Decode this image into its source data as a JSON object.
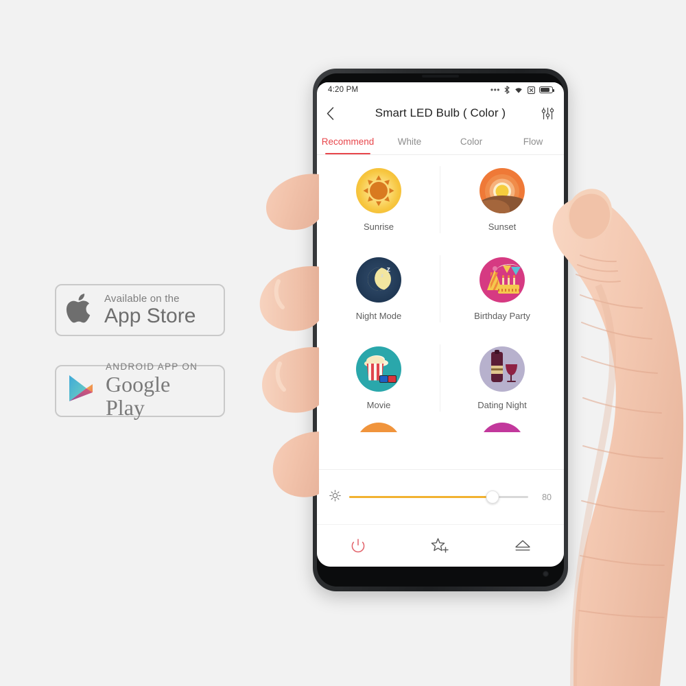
{
  "badges": {
    "appstore": {
      "small": "Available on the",
      "big": "App Store",
      "icon": "apple-logo-icon"
    },
    "googleplay": {
      "small": "ANDROID APP ON",
      "big": "Google Play",
      "icon": "google-play-triangle-icon"
    }
  },
  "phone": {
    "statusbar": {
      "time": "4:20 PM",
      "icons": [
        "more-dots-icon",
        "bluetooth-icon",
        "wifi-icon",
        "alarm-icon",
        "battery-icon"
      ]
    },
    "appbar": {
      "back_icon": "chevron-left-icon",
      "title": "Smart LED Bulb ( Color )",
      "settings_icon": "sliders-icon"
    },
    "tabs": [
      {
        "label": "Recommend",
        "active": true
      },
      {
        "label": "White",
        "active": false
      },
      {
        "label": "Color",
        "active": false
      },
      {
        "label": "Flow",
        "active": false
      }
    ],
    "scenes": [
      {
        "label": "Sunrise",
        "icon": "sunrise-icon"
      },
      {
        "label": "Sunset",
        "icon": "sunset-icon"
      },
      {
        "label": "Night Mode",
        "icon": "night-mode-icon"
      },
      {
        "label": "Birthday Party",
        "icon": "birthday-party-icon"
      },
      {
        "label": "Movie",
        "icon": "movie-icon"
      },
      {
        "label": "Dating Night",
        "icon": "dating-night-icon"
      }
    ],
    "brightness": {
      "icon": "brightness-icon",
      "value": "80",
      "percent": 80
    },
    "toolbar": [
      {
        "name": "power-icon",
        "label": "Power"
      },
      {
        "name": "star-plus-icon",
        "label": "Add favourite"
      },
      {
        "name": "eject-icon",
        "label": "Eject"
      }
    ]
  },
  "colors": {
    "accent_red": "#e8464b",
    "slider_amber": "#f2b230",
    "tab_inactive": "#8d8d8d",
    "background": "#f2f2f2"
  }
}
